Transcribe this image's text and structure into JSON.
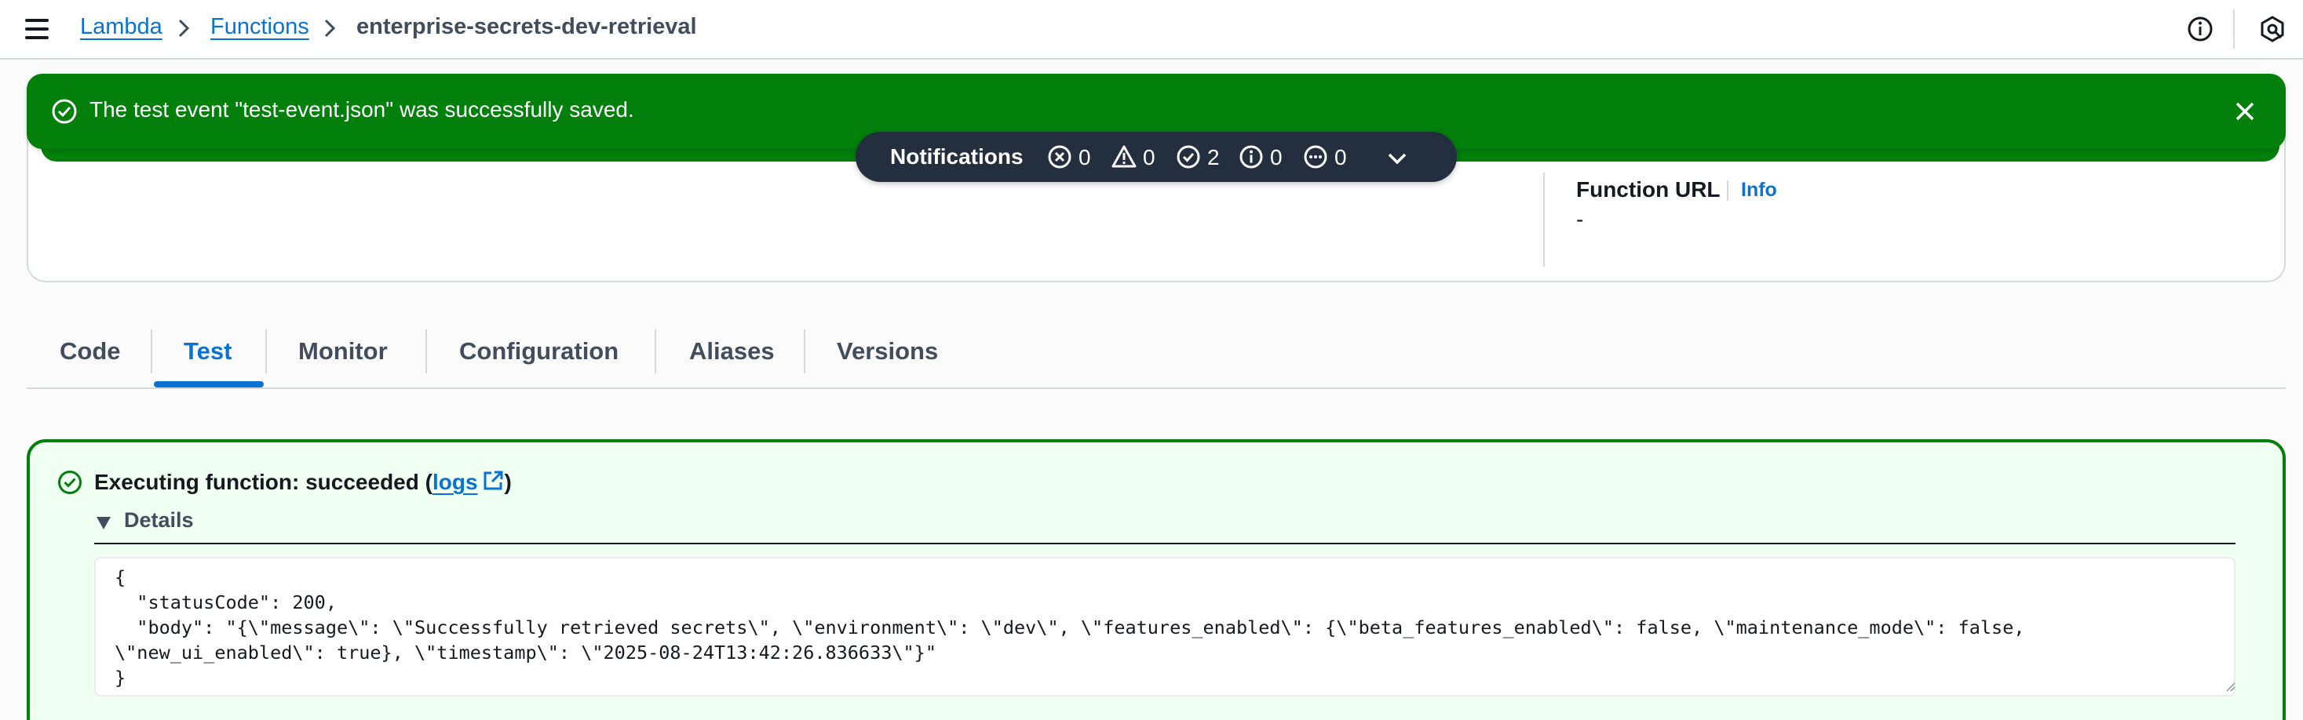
{
  "breadcrumb": {
    "items": [
      "Lambda",
      "Functions"
    ],
    "current": "enterprise-secrets-dev-retrieval"
  },
  "flash": {
    "message": "The test event \"test-event.json\" was successfully saved.",
    "type": "success"
  },
  "notifications": {
    "title": "Notifications",
    "counts": {
      "error": "0",
      "warning": "0",
      "success": "2",
      "info": "0",
      "in_progress": "0"
    }
  },
  "overview": {
    "function_url_label": "Function URL",
    "info_label": "Info",
    "function_url_value": "-"
  },
  "tabs": [
    {
      "label": "Code"
    },
    {
      "label": "Test",
      "active": true
    },
    {
      "label": "Monitor"
    },
    {
      "label": "Configuration"
    },
    {
      "label": "Aliases"
    },
    {
      "label": "Versions"
    }
  ],
  "result": {
    "title_prefix": "Executing function: succeeded (",
    "logs_label": "logs",
    "title_suffix": ")",
    "details_label": "Details",
    "output": "{\n  \"statusCode\": 200,\n  \"body\": \"{\\\"message\\\": \\\"Successfully retrieved secrets\\\", \\\"environment\\\": \\\"dev\\\", \\\"features_enabled\\\": {\\\"beta_features_enabled\\\": false, \\\"maintenance_mode\\\": false,\n\\\"new_ui_enabled\\\": true}, \\\"timestamp\\\": \\\"2025-08-24T13:42:26.836633\\\"}\"\n}"
  },
  "colors": {
    "success": "#037f0c",
    "link": "#0972d3",
    "notif_bg": "#232f3e",
    "result_bg": "#effff1"
  }
}
